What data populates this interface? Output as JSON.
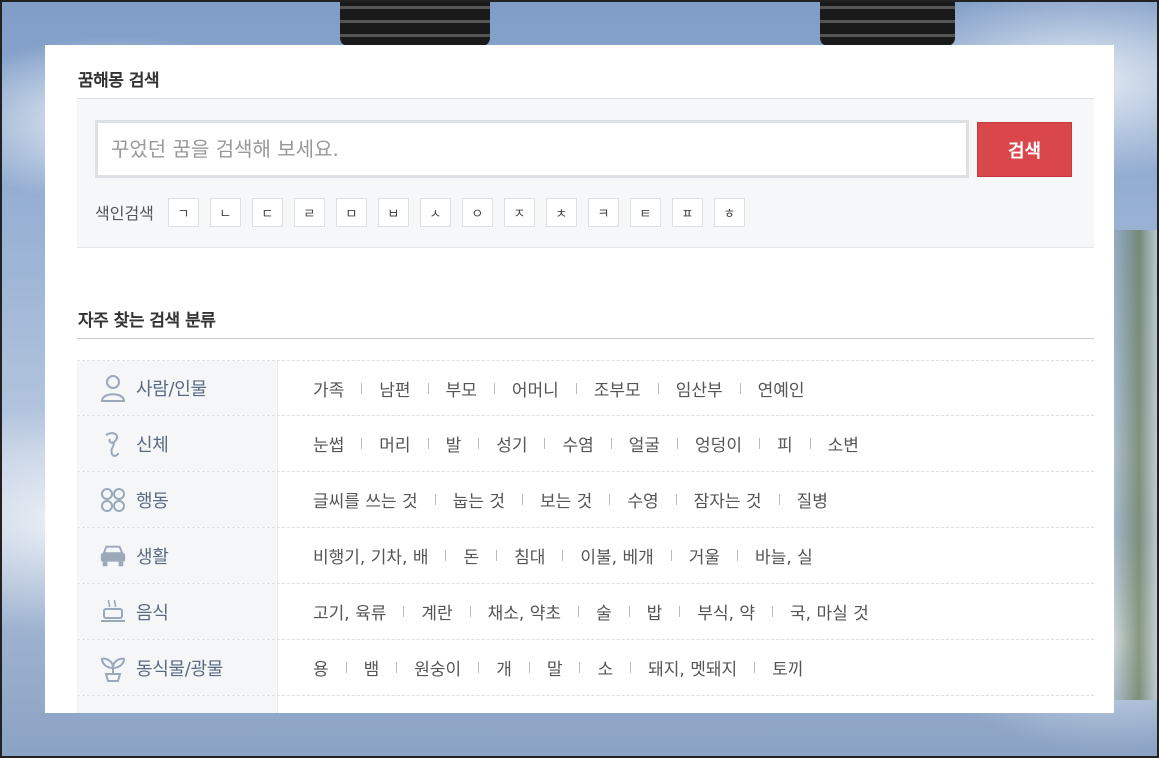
{
  "search_section": {
    "title": "꿈해몽 검색",
    "placeholder": "꾸었던 꿈을 검색해 보세요.",
    "button_label": "검색",
    "index_label": "색인검색",
    "index_letters": [
      "ㄱ",
      "ㄴ",
      "ㄷ",
      "ㄹ",
      "ㅁ",
      "ㅂ",
      "ㅅ",
      "ㅇ",
      "ㅈ",
      "ㅊ",
      "ㅋ",
      "ㅌ",
      "ㅍ",
      "ㅎ"
    ]
  },
  "category_section": {
    "title": "자주 찾는 검색 분류",
    "categories": [
      {
        "name": "사람/인물",
        "icon": "person-icon",
        "items": [
          "가족",
          "남편",
          "부모",
          "어머니",
          "조부모",
          "임산부",
          "연예인"
        ]
      },
      {
        "name": "신체",
        "icon": "body-icon",
        "items": [
          "눈썹",
          "머리",
          "발",
          "성기",
          "수염",
          "얼굴",
          "엉덩이",
          "피",
          "소변"
        ]
      },
      {
        "name": "행동",
        "icon": "action-icon",
        "items": [
          "글씨를 쓰는 것",
          "눕는 것",
          "보는 것",
          "수영",
          "잠자는 것",
          "질병"
        ]
      },
      {
        "name": "생활",
        "icon": "car-icon",
        "items": [
          "비행기, 기차, 배",
          "돈",
          "침대",
          "이불, 베개",
          "거울",
          "바늘, 실"
        ]
      },
      {
        "name": "음식",
        "icon": "food-icon",
        "items": [
          "고기, 육류",
          "계란",
          "채소, 약초",
          "술",
          "밥",
          "부식, 약",
          "국, 마실 것"
        ]
      },
      {
        "name": "동식물/광물",
        "icon": "plant-icon",
        "items": [
          "용",
          "뱀",
          "원숭이",
          "개",
          "말",
          "소",
          "돼지, 멧돼지",
          "토끼"
        ]
      }
    ]
  },
  "colors": {
    "accent": "#d9474a",
    "category_text": "#5a6a80",
    "icon": "#9aa8ba"
  }
}
